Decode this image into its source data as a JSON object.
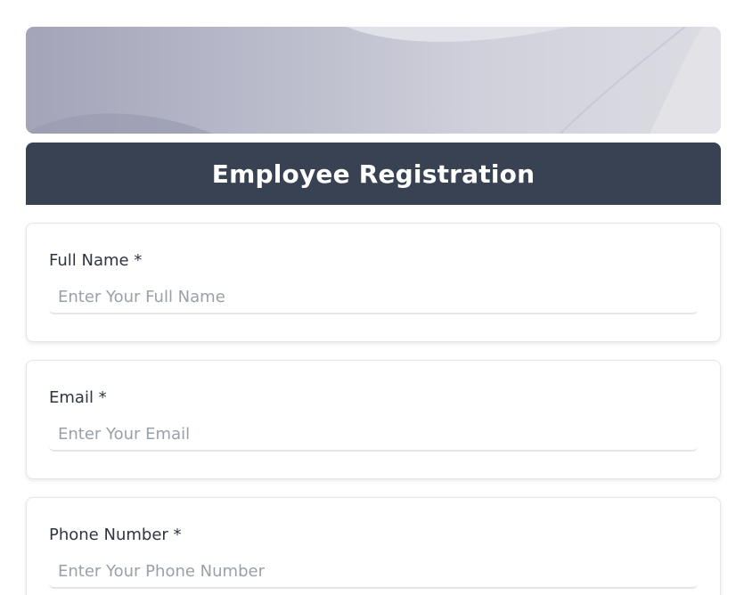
{
  "header": {
    "title": "Employee Registration"
  },
  "fields": [
    {
      "label": "Full Name *",
      "placeholder": "Enter Your Full Name",
      "value": ""
    },
    {
      "label": "Email *",
      "placeholder": "Enter Your Email",
      "value": ""
    },
    {
      "label": "Phone Number *",
      "placeholder": "Enter Your Phone Number",
      "value": ""
    }
  ],
  "colors": {
    "header_bg": "#394253",
    "header_text": "#ffffff",
    "label_text": "#2f3543",
    "placeholder_text": "#9aa0aa",
    "card_border": "#e4e5ea"
  }
}
